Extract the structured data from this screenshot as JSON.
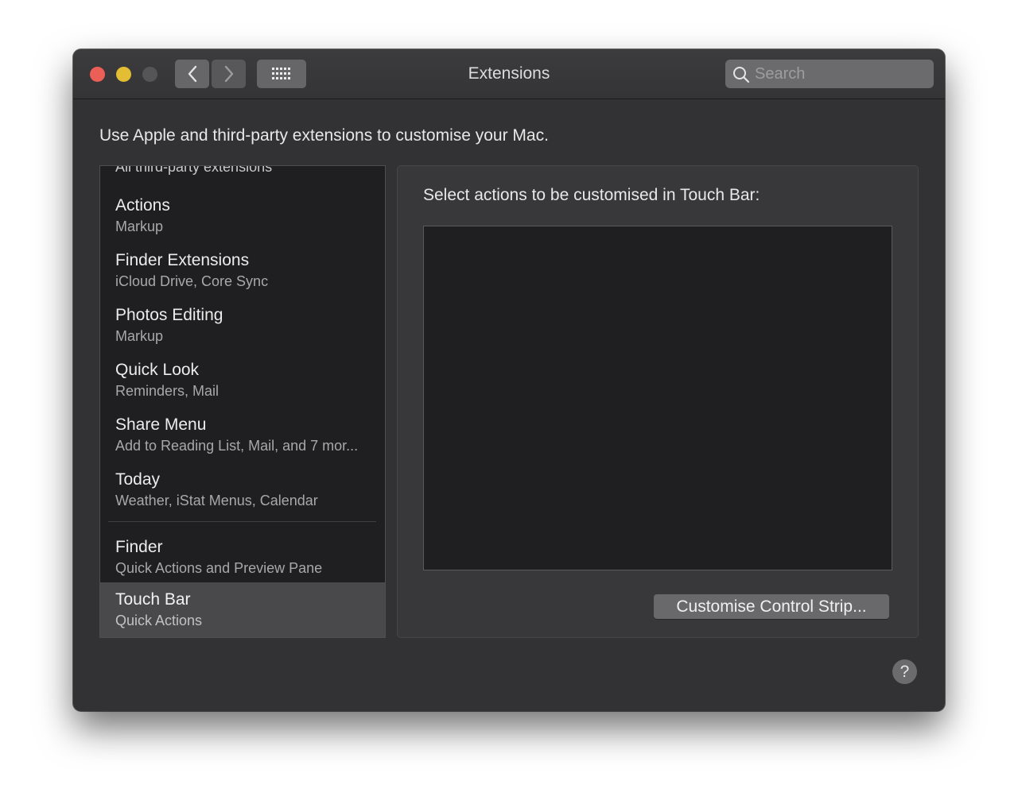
{
  "window": {
    "title": "Extensions",
    "traffic_lights": {
      "close": "#ec5f57",
      "minimize": "#e3bd33",
      "zoom": "#555557"
    }
  },
  "toolbar": {
    "back_icon": "chevron-left-icon",
    "forward_icon": "chevron-right-icon",
    "grid_icon": "grid-icon",
    "search": {
      "placeholder": "Search",
      "value": ""
    }
  },
  "description": "Use Apple and third-party extensions to customise your Mac.",
  "sidebar": {
    "cutoff_label": "All third-party extensions",
    "items": [
      {
        "name": "Actions",
        "sub": "Markup"
      },
      {
        "name": "Finder Extensions",
        "sub": "iCloud Drive, Core Sync"
      },
      {
        "name": "Photos Editing",
        "sub": "Markup"
      },
      {
        "name": "Quick Look",
        "sub": "Reminders, Mail"
      },
      {
        "name": "Share Menu",
        "sub": "Add to Reading List, Mail, and 7 mor..."
      },
      {
        "name": "Today",
        "sub": "Weather, iStat Menus, Calendar"
      }
    ],
    "system_items": [
      {
        "name": "Finder",
        "sub": "Quick Actions and Preview Pane"
      },
      {
        "name": "Touch Bar",
        "sub": "Quick Actions",
        "selected": true
      }
    ]
  },
  "panel": {
    "heading": "Select actions to be customised in Touch Bar:",
    "button": "Customise Control Strip..."
  },
  "help_label": "?"
}
